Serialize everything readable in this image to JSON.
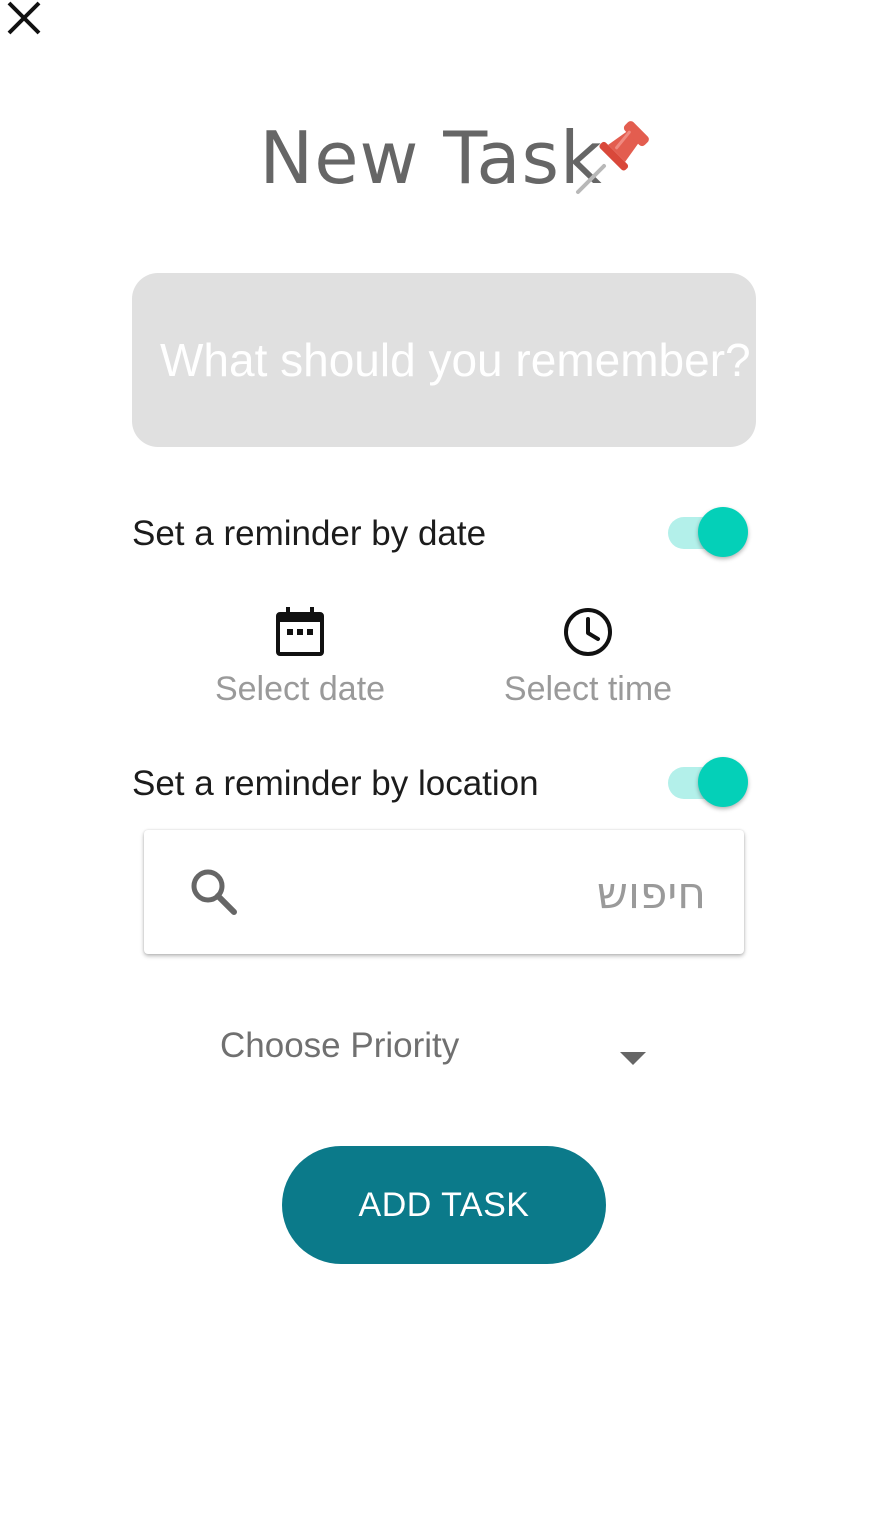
{
  "close": {
    "icon": "close-icon"
  },
  "header": {
    "title": "New Task",
    "icon": "pushpin-icon"
  },
  "task_input": {
    "value": "",
    "placeholder": "What should you remember?"
  },
  "date_reminder": {
    "label": "Set a reminder by date",
    "enabled": true,
    "date_picker": {
      "icon": "calendar-icon",
      "label": "Select date"
    },
    "time_picker": {
      "icon": "clock-icon",
      "label": "Select time"
    }
  },
  "location_reminder": {
    "label": "Set a reminder by location",
    "enabled": true,
    "search": {
      "icon": "search-icon",
      "value": "",
      "placeholder": "חיפוש"
    }
  },
  "priority": {
    "label": "Choose Priority",
    "icon": "caret-down-icon"
  },
  "actions": {
    "add_label": "ADD TASK"
  },
  "colors": {
    "accent": "#04d0b8",
    "accent_track": "#b3f0ea",
    "button": "#0b7a8a",
    "input_background": "#e0e0e0",
    "pin": "#e35d4f",
    "title_text": "#666666"
  }
}
